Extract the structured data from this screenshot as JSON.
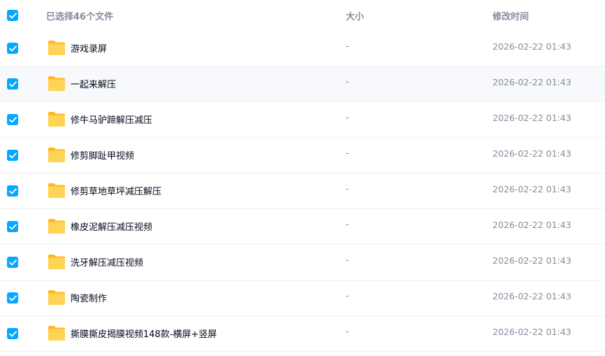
{
  "header": {
    "selection_label": "已选择46个文件",
    "size_label": "大小",
    "mtime_label": "修改时间"
  },
  "colors": {
    "checkbox": "#06a7ff",
    "folder": "#ffc933",
    "muted_text": "#878c9c",
    "primary_text": "#03081a"
  },
  "rows": [
    {
      "name": "游戏录屏",
      "size": "-",
      "mtime": "2026-02-22 01:43",
      "checked": true,
      "icon": "folder-icon"
    },
    {
      "name": "一起来解压",
      "size": "-",
      "mtime": "2026-02-22 01:43",
      "checked": true,
      "icon": "folder-icon"
    },
    {
      "name": "修牛马驴蹄解压减压",
      "size": "-",
      "mtime": "2026-02-22 01:43",
      "checked": true,
      "icon": "folder-icon"
    },
    {
      "name": "修剪脚趾甲视频",
      "size": "-",
      "mtime": "2026-02-22 01:43",
      "checked": true,
      "icon": "folder-icon"
    },
    {
      "name": "修剪草地草坪减压解压",
      "size": "-",
      "mtime": "2026-02-22 01:43",
      "checked": true,
      "icon": "folder-icon"
    },
    {
      "name": "橡皮泥解压减压视频",
      "size": "-",
      "mtime": "2026-02-22 01:43",
      "checked": true,
      "icon": "folder-icon"
    },
    {
      "name": "洗牙解压减压视频",
      "size": "-",
      "mtime": "2026-02-22 01:43",
      "checked": true,
      "icon": "folder-icon"
    },
    {
      "name": "陶瓷制作",
      "size": "-",
      "mtime": "2026-02-22 01:43",
      "checked": true,
      "icon": "folder-icon"
    },
    {
      "name": "撕膜撕皮揭膜视频148款-横屏+竖屏",
      "size": "-",
      "mtime": "2026-02-22 01:43",
      "checked": true,
      "icon": "folder-icon"
    }
  ]
}
